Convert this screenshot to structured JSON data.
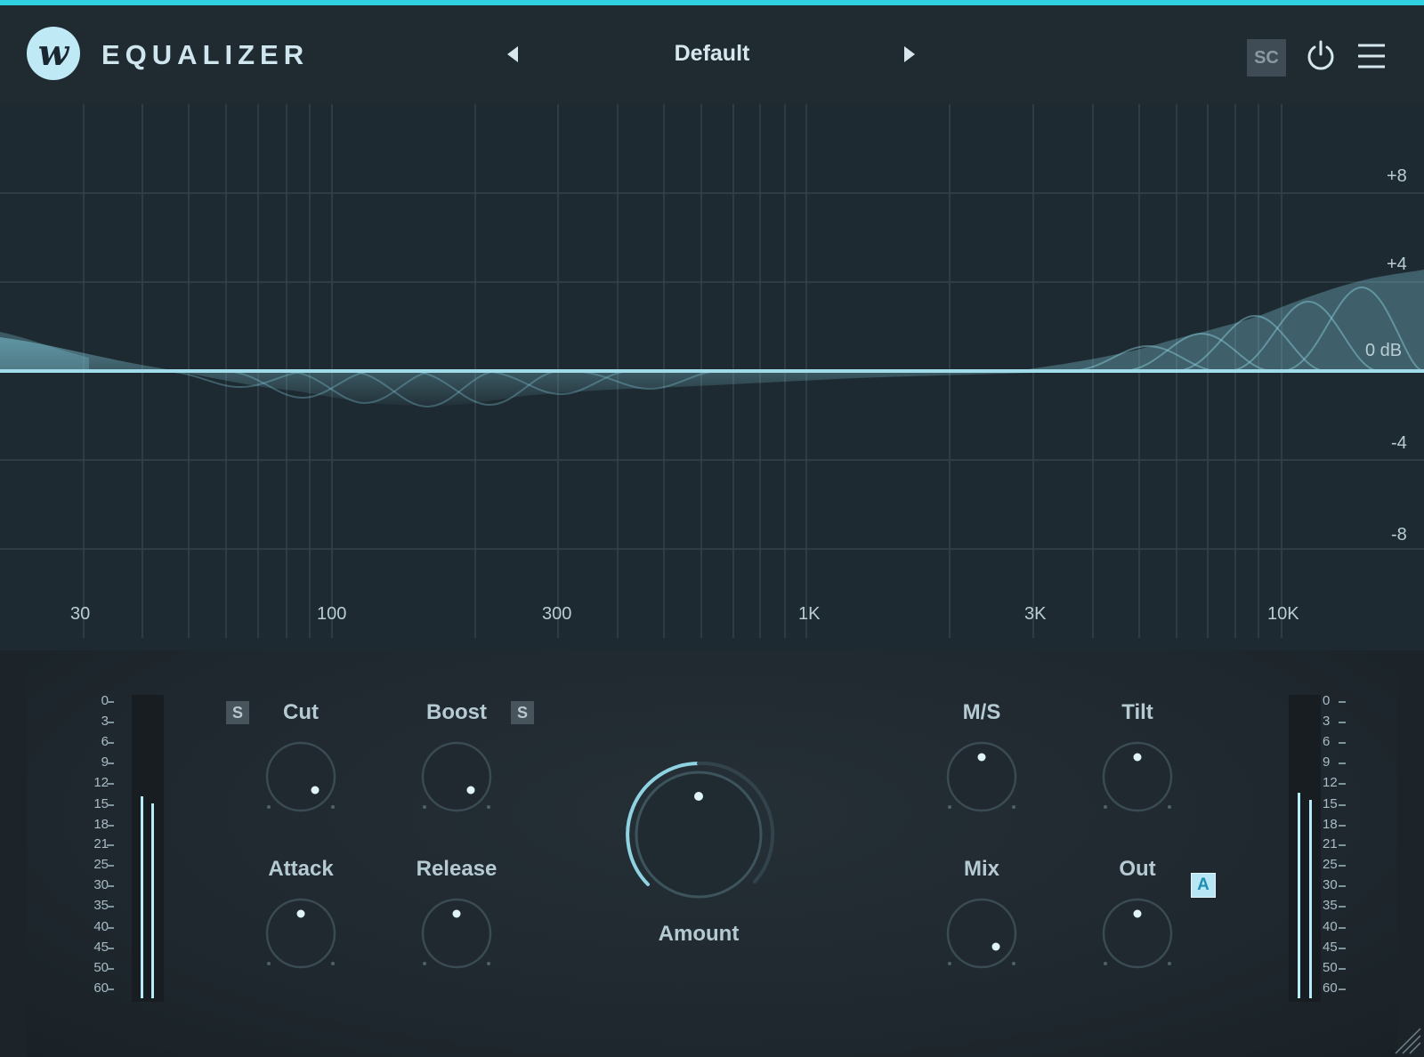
{
  "header": {
    "app_title": "EQUALIZER",
    "preset_name": "Default",
    "sidechain_label": "SC",
    "icons": [
      "logo-w-icon",
      "caret-left-icon",
      "caret-right-icon",
      "power-icon",
      "hamburger-menu-icon"
    ]
  },
  "graph": {
    "db_labels": [
      "+8",
      "+4",
      "0 dB",
      "-4",
      "-8"
    ],
    "freq_labels": [
      "30",
      "100",
      "300",
      "1K",
      "3K",
      "10K"
    ]
  },
  "controls": {
    "cut": {
      "label": "Cut",
      "solo": "S"
    },
    "boost": {
      "label": "Boost",
      "solo": "S"
    },
    "attack": {
      "label": "Attack"
    },
    "release": {
      "label": "Release"
    },
    "amount": {
      "label": "Amount"
    },
    "ms": {
      "label": "M/S"
    },
    "tilt": {
      "label": "Tilt"
    },
    "mix": {
      "label": "Mix"
    },
    "out": {
      "label": "Out",
      "auto": "A"
    }
  },
  "meters": {
    "scale": [
      "0",
      "3",
      "6",
      "9",
      "12",
      "15",
      "18",
      "21",
      "25",
      "30",
      "35",
      "40",
      "45",
      "50",
      "60"
    ]
  },
  "colors": {
    "accent": "#2fd0e2",
    "background": "#1b2329",
    "curve": "#8fd3e3"
  }
}
